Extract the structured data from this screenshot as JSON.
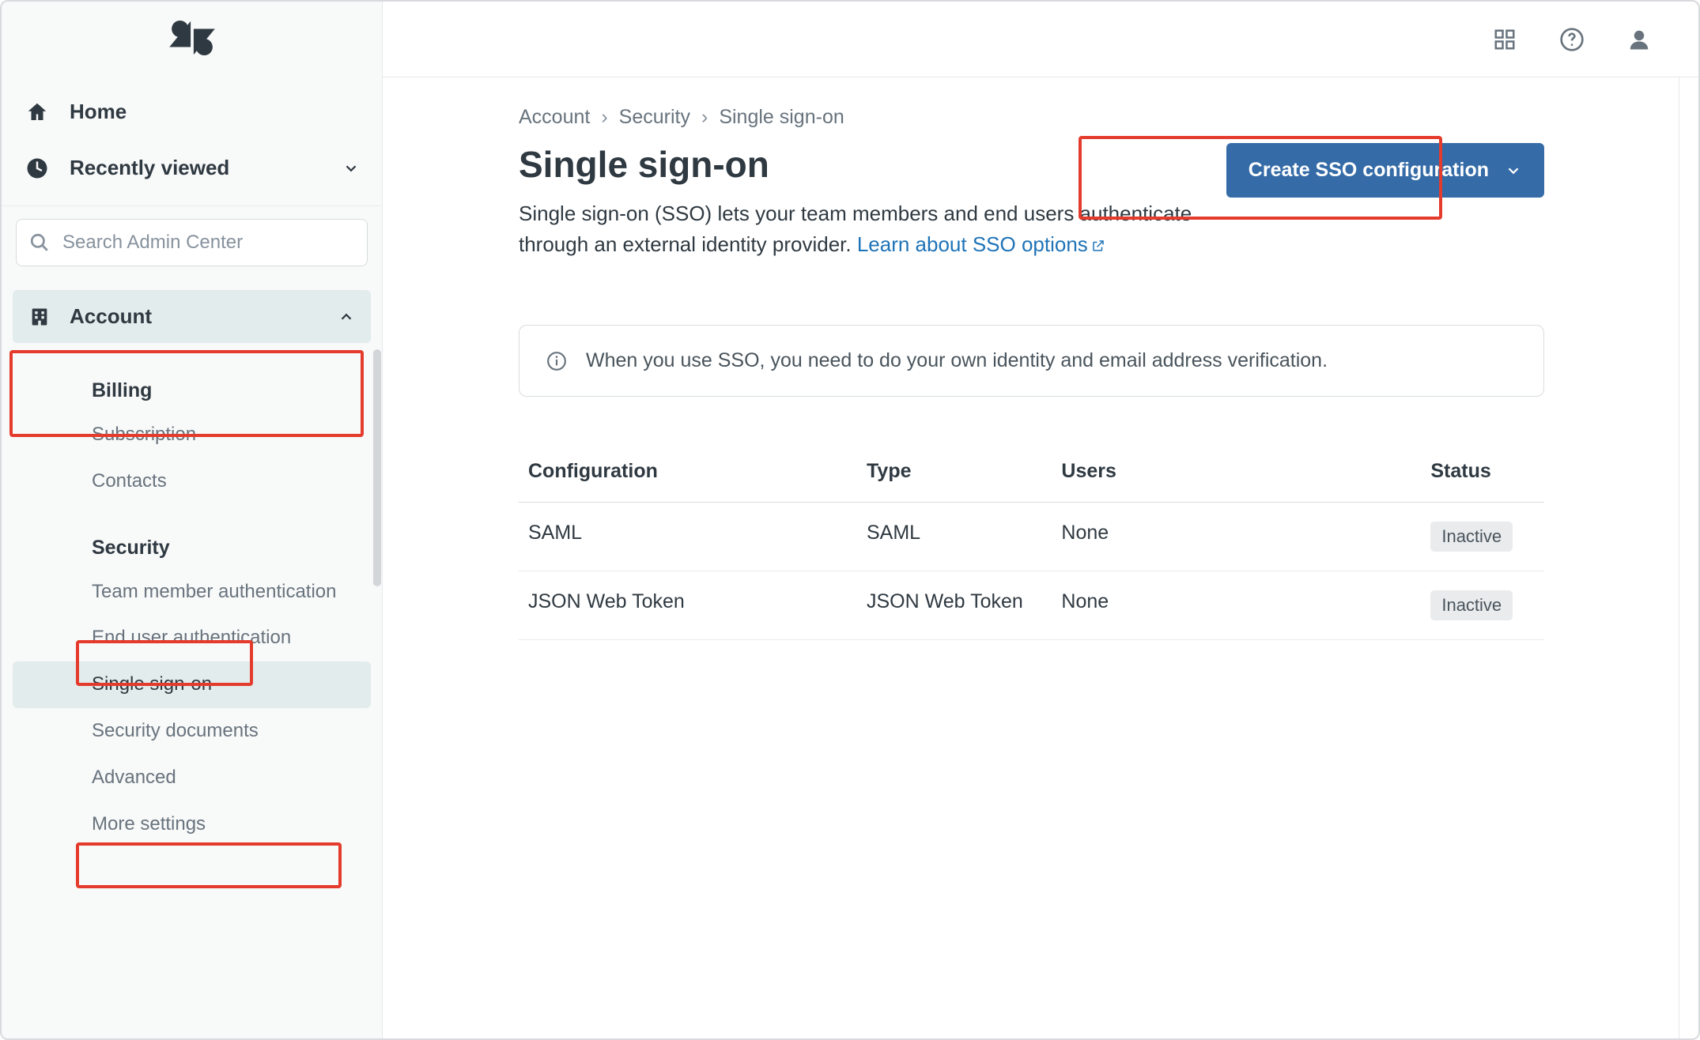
{
  "sidebar": {
    "home": "Home",
    "recently_viewed": "Recently viewed",
    "search_placeholder": "Search Admin Center",
    "category": "Account",
    "group1_heading": "Billing",
    "group1_items": [
      "Subscription",
      "Contacts"
    ],
    "group2_heading": "Security",
    "group2_items": [
      "Team member authentication",
      "End user authentication",
      "Single sign-on",
      "Security documents",
      "Advanced",
      "More settings"
    ],
    "active_item": "Single sign-on"
  },
  "breadcrumb": [
    "Account",
    "Security",
    "Single sign-on"
  ],
  "page": {
    "title": "Single sign-on",
    "subtitle_pre": "Single sign-on (SSO) lets your team members and end users authenticate through an external identity provider. ",
    "learn_link": "Learn about SSO options",
    "create_button": "Create SSO configuration"
  },
  "banner": "When you use SSO, you need to do your own identity and email address verification.",
  "table": {
    "headers": [
      "Configuration",
      "Type",
      "Users",
      "Status"
    ],
    "rows": [
      {
        "config": "SAML",
        "type": "SAML",
        "users": "None",
        "status": "Inactive"
      },
      {
        "config": "JSON Web Token",
        "type": "JSON Web Token",
        "users": "None",
        "status": "Inactive"
      }
    ]
  }
}
